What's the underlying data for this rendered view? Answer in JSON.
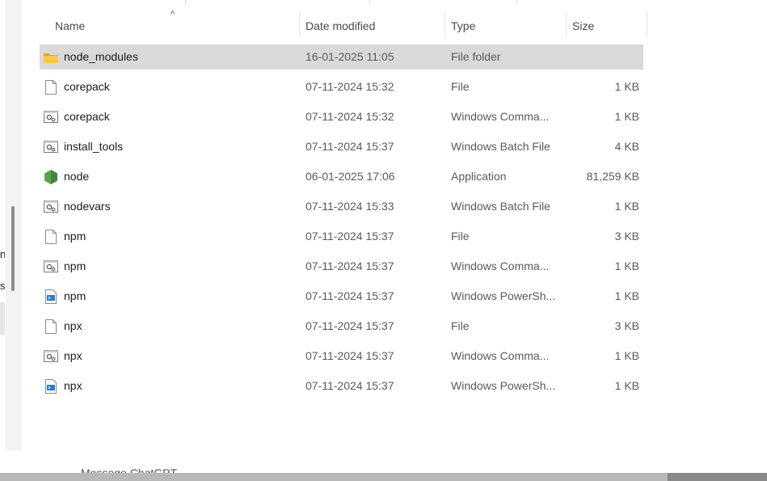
{
  "columns": {
    "name": "Name",
    "date_modified": "Date modified",
    "type": "Type",
    "size": "Size"
  },
  "files": [
    {
      "name": "node_modules",
      "date": "16-01-2025 11:05",
      "type": "File folder",
      "size": "",
      "icon": "folder-icon",
      "selected": true
    },
    {
      "name": "corepack",
      "date": "07-11-2024 15:32",
      "type": "File",
      "size": "1 KB",
      "icon": "file-icon"
    },
    {
      "name": "corepack",
      "date": "07-11-2024 15:32",
      "type": "Windows Comma...",
      "size": "1 KB",
      "icon": "script-icon"
    },
    {
      "name": "install_tools",
      "date": "07-11-2024 15:37",
      "type": "Windows Batch File",
      "size": "4 KB",
      "icon": "script-icon"
    },
    {
      "name": "node",
      "date": "06-01-2025 17:06",
      "type": "Application",
      "size": "81,259 KB",
      "icon": "nodejs-icon"
    },
    {
      "name": "nodevars",
      "date": "07-11-2024 15:33",
      "type": "Windows Batch File",
      "size": "1 KB",
      "icon": "script-icon"
    },
    {
      "name": "npm",
      "date": "07-11-2024 15:37",
      "type": "File",
      "size": "3 KB",
      "icon": "file-icon"
    },
    {
      "name": "npm",
      "date": "07-11-2024 15:37",
      "type": "Windows Comma...",
      "size": "1 KB",
      "icon": "script-icon"
    },
    {
      "name": "npm",
      "date": "07-11-2024 15:37",
      "type": "Windows PowerSh...",
      "size": "1 KB",
      "icon": "powershell-icon"
    },
    {
      "name": "npx",
      "date": "07-11-2024 15:37",
      "type": "File",
      "size": "3 KB",
      "icon": "file-icon"
    },
    {
      "name": "npx",
      "date": "07-11-2024 15:37",
      "type": "Windows Comma...",
      "size": "1 KB",
      "icon": "script-icon"
    },
    {
      "name": "npx",
      "date": "07-11-2024 15:37",
      "type": "Windows PowerSh...",
      "size": "1 KB",
      "icon": "powershell-icon"
    }
  ],
  "nav_fragments": [
    "n",
    "s"
  ],
  "chat_hint": "Message ChatGPT",
  "colors": {
    "selected_row": "#d9d9d9",
    "folder": "#f4c23b",
    "node_green": "#4caf50"
  }
}
